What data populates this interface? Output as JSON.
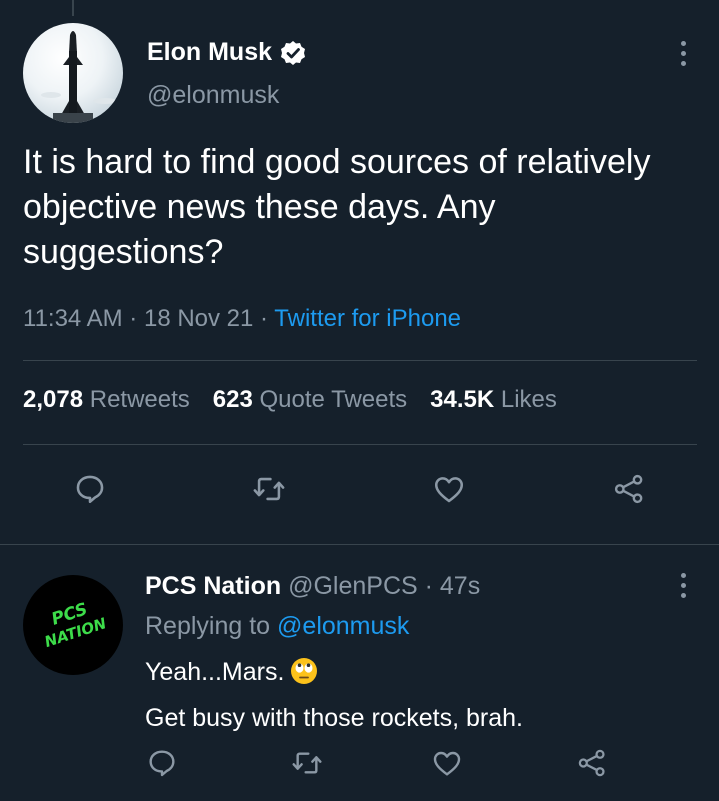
{
  "colors": {
    "background": "#15202b",
    "text_primary": "#ffffff",
    "text_secondary": "#8b98a5",
    "accent": "#1d9bf0",
    "divider": "#38444d"
  },
  "tweet": {
    "author_name": "Elon Musk",
    "verified": true,
    "handle": "@elonmusk",
    "text": "It is hard to find good sources of relatively objective news these days. Any suggestions?",
    "time": "11:34 AM",
    "date": "18 Nov 21",
    "separator": "·",
    "source": "Twitter for iPhone",
    "stats": {
      "retweets_count": "2,078",
      "retweets_label": "Retweets",
      "quotes_count": "623",
      "quotes_label": "Quote Tweets",
      "likes_count": "34.5K",
      "likes_label": "Likes"
    },
    "actions": [
      "reply-icon",
      "retweet-icon",
      "like-icon",
      "share-icon"
    ]
  },
  "reply": {
    "author_name": "PCS Nation",
    "handle": "@GlenPCS",
    "separator": "·",
    "time_ago": "47s",
    "replying_to_prefix": "Replying to",
    "replying_to_handle": "@elonmusk",
    "line1": "Yeah...Mars.",
    "line1_emoji": "face-with-rolling-eyes",
    "line2": "Get busy with those rockets, brah.",
    "avatar_text_line1": "PCS",
    "avatar_text_line2": "NATION",
    "avatar_text_color": "#3ddc4a",
    "actions": [
      "reply-icon",
      "retweet-icon",
      "like-icon",
      "share-icon"
    ]
  }
}
